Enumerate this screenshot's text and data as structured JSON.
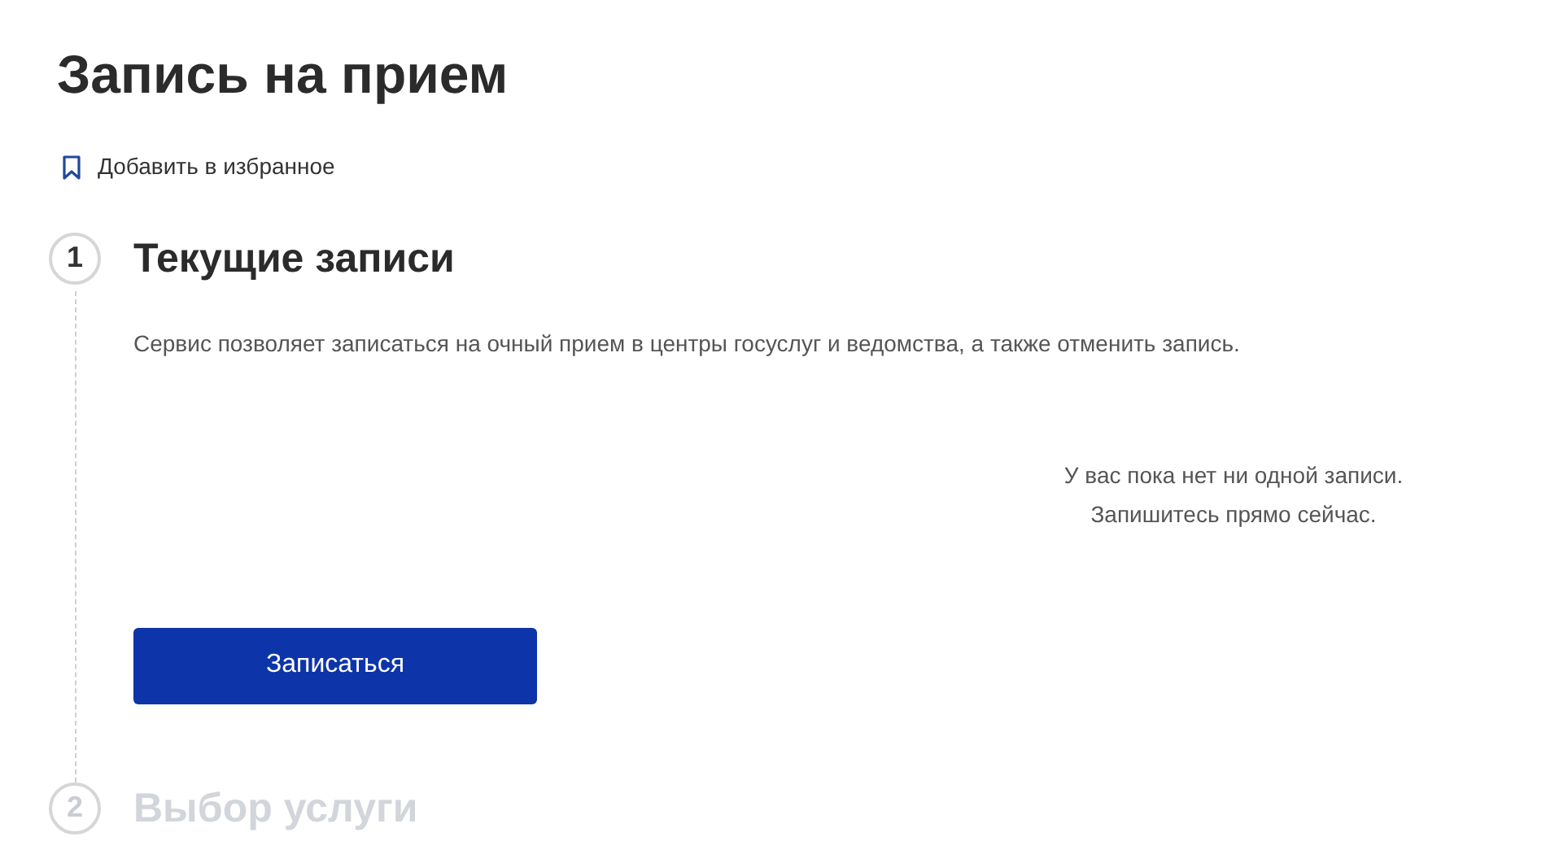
{
  "page_title": "Запись на прием",
  "favorite_link": "Добавить в избранное",
  "steps": [
    {
      "number": "1",
      "title": "Текущие записи",
      "active": true,
      "description": "Сервис позволяет записаться на очный прием в центры госуслуг и ведомства, а также отменить запись.",
      "empty_message": [
        "У вас пока нет ни одной записи.",
        "Запишитесь прямо сейчас."
      ],
      "button": "Записаться"
    },
    {
      "number": "2",
      "title": "Выбор услуги",
      "active": false
    }
  ]
}
